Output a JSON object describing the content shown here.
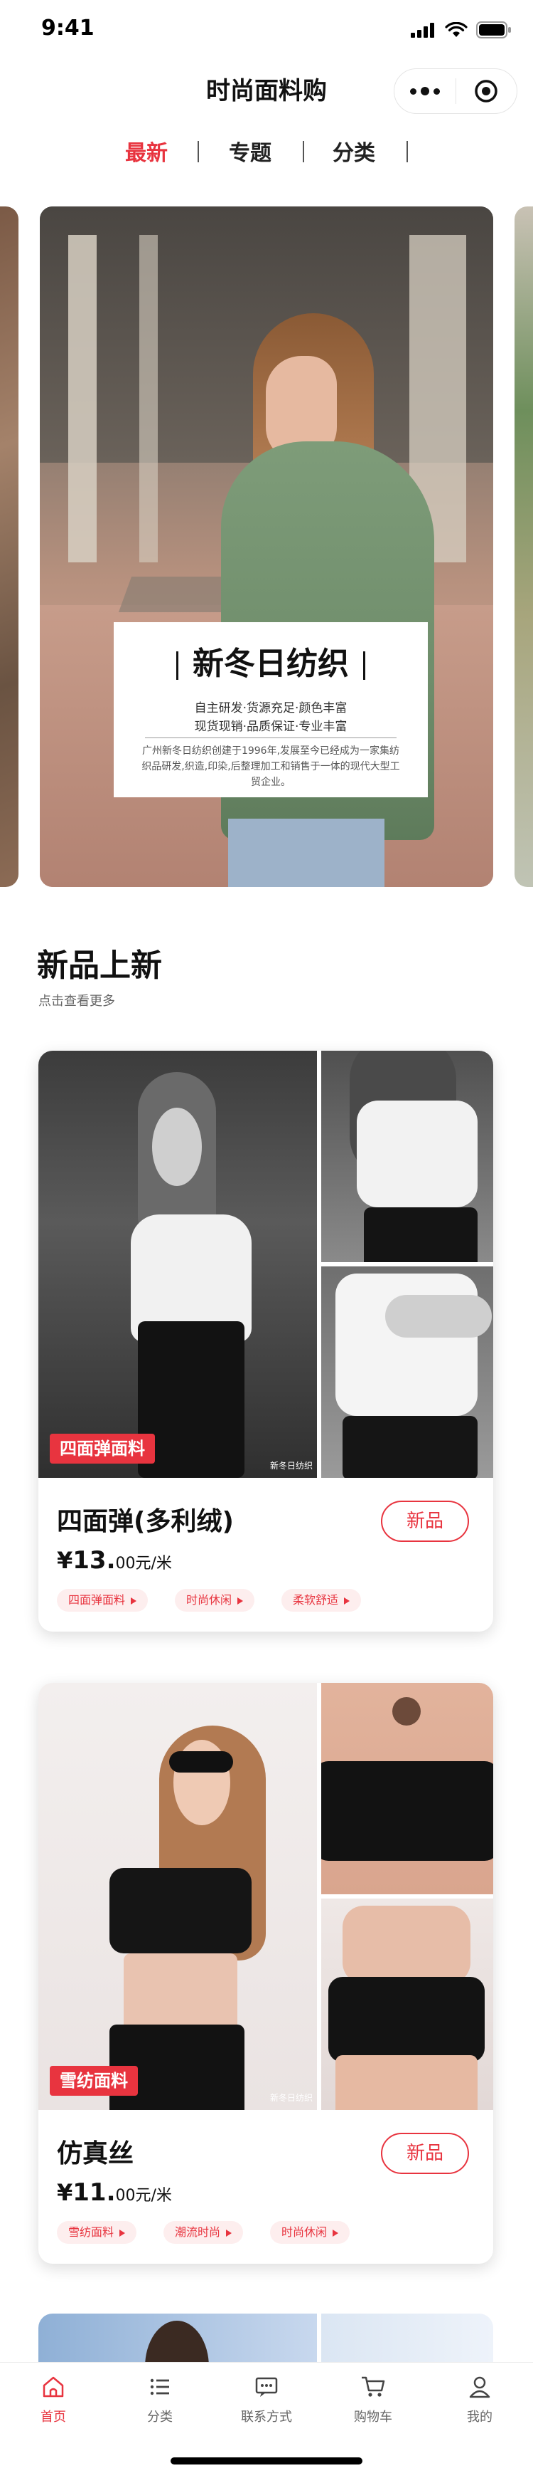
{
  "status_bar": {
    "time": "9:41"
  },
  "header": {
    "title": "时尚面料购"
  },
  "tabs": [
    {
      "label": "最新",
      "active": true
    },
    {
      "label": "专题",
      "active": false
    },
    {
      "label": "分类",
      "active": false
    }
  ],
  "banner": {
    "title": "新冬日纺织",
    "line1": "自主研发·货源充足·颜色丰富",
    "line2": "现货现销·品质保证·专业丰富",
    "description": "广州新冬日纺织创建于1996年,发展至今已经成为一家集纺织品研发,织造,印染,后整理加工和销售于一体的现代大型工贸企业。"
  },
  "section": {
    "title": "新品上新",
    "subtitle": "点击查看更多"
  },
  "products": [
    {
      "tag": "四面弹面料",
      "watermark": "新冬日纺织",
      "name": "四面弹(多利绒)",
      "currency": "¥",
      "price_int": "13.",
      "price_dec": "00元/米",
      "badge": "新品",
      "chips": [
        "四面弹面料",
        "时尚休闲",
        "柔软舒适"
      ]
    },
    {
      "tag": "雪纺面料",
      "watermark": "新冬日纺织",
      "name": "仿真丝",
      "currency": "¥",
      "price_int": "11.",
      "price_dec": "00元/米",
      "badge": "新品",
      "chips": [
        "雪纺面料",
        "潮流时尚",
        "时尚休闲"
      ]
    }
  ],
  "tabbar": [
    {
      "label": "首页",
      "icon": "home-icon",
      "active": true
    },
    {
      "label": "分类",
      "icon": "list-icon",
      "active": false
    },
    {
      "label": "联系方式",
      "icon": "message-icon",
      "active": false
    },
    {
      "label": "购物车",
      "icon": "cart-icon",
      "active": false
    },
    {
      "label": "我的",
      "icon": "user-icon",
      "active": false
    }
  ],
  "colors": {
    "accent": "#e8343f",
    "text": "#111111",
    "muted": "#666666"
  }
}
